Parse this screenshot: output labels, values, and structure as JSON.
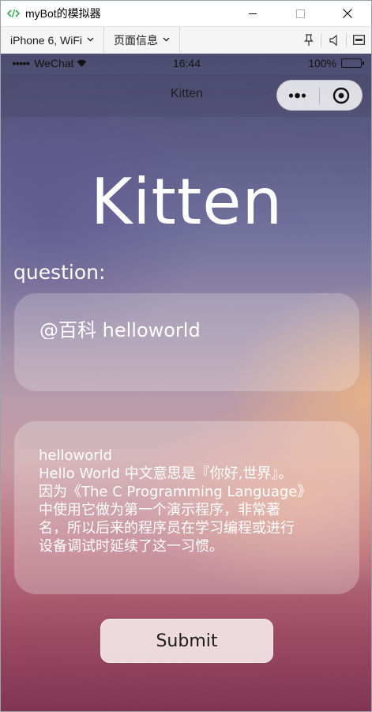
{
  "window": {
    "title": "myBot的模拟器",
    "accent_color": "#33a854"
  },
  "toolbar": {
    "device_select": "iPhone 6, WiFi",
    "page_info_select": "页面信息"
  },
  "statusbar": {
    "signal_dots": "●●●●●",
    "carrier": "WeChat",
    "time": "16:44",
    "battery": "100%"
  },
  "navbar": {
    "title": "Kitten"
  },
  "page": {
    "hero_title": "Kitten",
    "question_label": "question:",
    "question_value": "@百科 helloworld",
    "answer_title": "helloworld",
    "answer_body": "Hello World 中文意思是『你好,世界』。\n因为《The C Programming Language》\n中使用它做为第一个演示程序，非常著\n名，所以后来的程序员在学习编程或进行\n设备调试时延续了这一习惯。",
    "submit_label": "Submit"
  }
}
